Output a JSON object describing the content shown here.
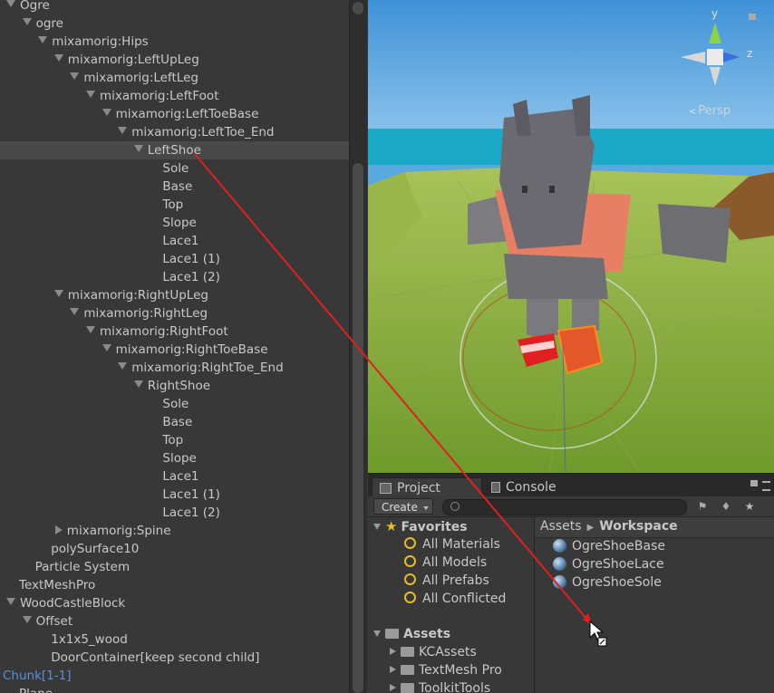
{
  "hierarchy": {
    "rows": [
      {
        "label": "Ogre",
        "indent": 0,
        "arrow": "down"
      },
      {
        "label": "ogre",
        "indent": 1,
        "arrow": "down"
      },
      {
        "label": "mixamorig:Hips",
        "indent": 2,
        "arrow": "down"
      },
      {
        "label": "mixamorig:LeftUpLeg",
        "indent": 3,
        "arrow": "down"
      },
      {
        "label": "mixamorig:LeftLeg",
        "indent": 4,
        "arrow": "down"
      },
      {
        "label": "mixamorig:LeftFoot",
        "indent": 5,
        "arrow": "down"
      },
      {
        "label": "mixamorig:LeftToeBase",
        "indent": 6,
        "arrow": "down"
      },
      {
        "label": "mixamorig:LeftToe_End",
        "indent": 7,
        "arrow": "down"
      },
      {
        "label": "LeftShoe",
        "indent": 8,
        "arrow": "down",
        "selected": true
      },
      {
        "label": "Sole",
        "indent": 9,
        "arrow": "none"
      },
      {
        "label": "Base",
        "indent": 9,
        "arrow": "none"
      },
      {
        "label": "Top",
        "indent": 9,
        "arrow": "none"
      },
      {
        "label": "Slope",
        "indent": 9,
        "arrow": "none"
      },
      {
        "label": "Lace1",
        "indent": 9,
        "arrow": "none"
      },
      {
        "label": "Lace1 (1)",
        "indent": 9,
        "arrow": "none"
      },
      {
        "label": "Lace1 (2)",
        "indent": 9,
        "arrow": "none"
      },
      {
        "label": "mixamorig:RightUpLeg",
        "indent": 3,
        "arrow": "down"
      },
      {
        "label": "mixamorig:RightLeg",
        "indent": 4,
        "arrow": "down"
      },
      {
        "label": "mixamorig:RightFoot",
        "indent": 5,
        "arrow": "down"
      },
      {
        "label": "mixamorig:RightToeBase",
        "indent": 6,
        "arrow": "down"
      },
      {
        "label": "mixamorig:RightToe_End",
        "indent": 7,
        "arrow": "down"
      },
      {
        "label": "RightShoe",
        "indent": 8,
        "arrow": "down"
      },
      {
        "label": "Sole",
        "indent": 9,
        "arrow": "none"
      },
      {
        "label": "Base",
        "indent": 9,
        "arrow": "none"
      },
      {
        "label": "Top",
        "indent": 9,
        "arrow": "none"
      },
      {
        "label": "Slope",
        "indent": 9,
        "arrow": "none"
      },
      {
        "label": "Lace1",
        "indent": 9,
        "arrow": "none"
      },
      {
        "label": "Lace1 (1)",
        "indent": 9,
        "arrow": "none"
      },
      {
        "label": "Lace1 (2)",
        "indent": 9,
        "arrow": "none"
      },
      {
        "label": "mixamorig:Spine",
        "indent": 3,
        "arrow": "right"
      },
      {
        "label": "polySurface10",
        "indent": 2,
        "arrow": "none"
      },
      {
        "label": "Particle System",
        "indent": 1,
        "arrow": "none"
      },
      {
        "label": "TextMeshPro",
        "indent": 0,
        "arrow": "none"
      },
      {
        "label": "WoodCastleBlock",
        "indent": 0,
        "arrow": "down"
      },
      {
        "label": "Offset",
        "indent": 1,
        "arrow": "down"
      },
      {
        "label": "1x1x5_wood",
        "indent": 2,
        "arrow": "none"
      },
      {
        "label": "DoorContainer[keep second child]",
        "indent": 2,
        "arrow": "none"
      },
      {
        "label": "Chunk[1-1]",
        "indent": -1,
        "arrow": "none",
        "blue": true
      },
      {
        "label": "Plane",
        "indent": 0,
        "arrow": "none"
      }
    ]
  },
  "scene": {
    "gizmo_labels": {
      "y": "y",
      "z": "z"
    },
    "persp_label": "Persp"
  },
  "project": {
    "tabs": [
      {
        "label": "Project",
        "active": true
      },
      {
        "label": "Console",
        "active": false
      }
    ],
    "create_label": "Create",
    "favorites_label": "Favorites",
    "favorites": [
      "All Materials",
      "All Models",
      "All Prefabs",
      "All Conflicted"
    ],
    "assets_label": "Assets",
    "asset_folders": [
      "KCAssets",
      "TextMesh Pro",
      "ToolkitTools"
    ],
    "breadcrumb": {
      "root": "Assets",
      "current": "Workspace"
    },
    "files": [
      "OgreShoeBase",
      "OgreShoeLace",
      "OgreShoeSole"
    ]
  },
  "colors": {
    "selection_row": "#484848",
    "drag_line": "#e02020",
    "favorites_star": "#e8b92b"
  }
}
